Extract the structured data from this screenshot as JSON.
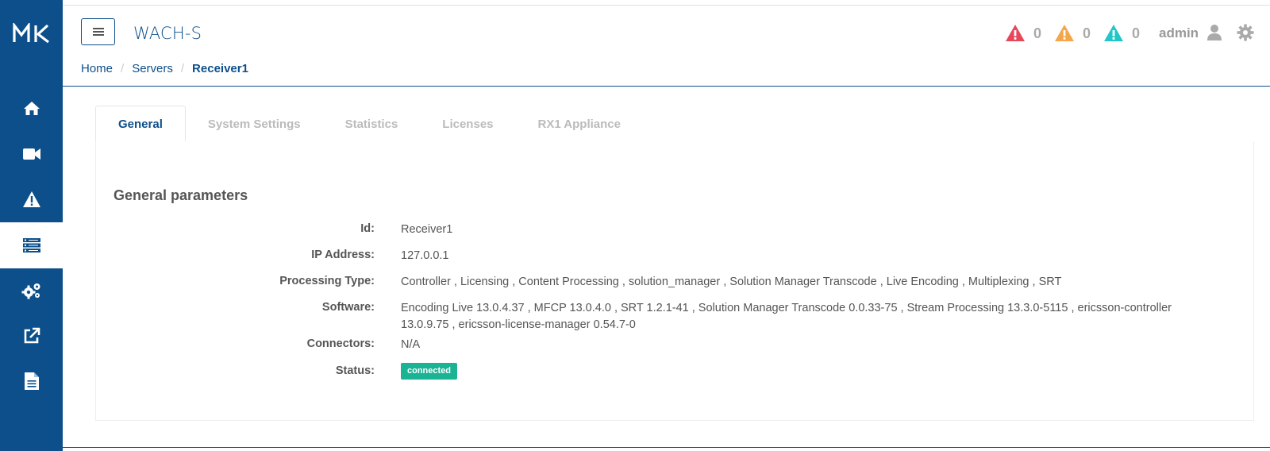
{
  "app": {
    "logo_text": "MK",
    "title": "WACH-S"
  },
  "sidebar": {
    "items": [
      {
        "name": "home",
        "icon": "home-icon"
      },
      {
        "name": "video",
        "icon": "video-camera-icon"
      },
      {
        "name": "alarms",
        "icon": "warning-icon"
      },
      {
        "name": "servers",
        "icon": "server-icon",
        "active": true
      },
      {
        "name": "settings",
        "icon": "cogs-icon"
      },
      {
        "name": "external",
        "icon": "external-link-icon"
      },
      {
        "name": "docs",
        "icon": "document-icon"
      }
    ]
  },
  "header": {
    "alerts": [
      {
        "level": "critical",
        "count": "0",
        "color": "#e5485b"
      },
      {
        "level": "major",
        "count": "0",
        "color": "#f5a54a"
      },
      {
        "level": "minor",
        "count": "0",
        "color": "#23c6c8"
      }
    ],
    "user": "admin"
  },
  "breadcrumb": {
    "home": "Home",
    "servers": "Servers",
    "current": "Receiver1"
  },
  "tabs": [
    {
      "label": "General",
      "active": true
    },
    {
      "label": "System Settings"
    },
    {
      "label": "Statistics"
    },
    {
      "label": "Licenses"
    },
    {
      "label": "RX1 Appliance"
    }
  ],
  "general": {
    "title": "General parameters",
    "rows": [
      {
        "label": "Id:",
        "value": "Receiver1"
      },
      {
        "label": "IP Address:",
        "value": "127.0.0.1"
      },
      {
        "label": "Processing Type:",
        "value": "Controller , Licensing , Content Processing , solution_manager , Solution Manager Transcode , Live Encoding , Multiplexing , SRT"
      },
      {
        "label": "Software:",
        "value_line1": "Encoding Live 13.0.4.37 , MFCP 13.0.4.0 , SRT 1.2.1-41 , Solution Manager Transcode 0.0.33-75 , Stream Processing 13.3.0-5115 , ericsson-controller",
        "value_line2": "13.0.9.75 , ericsson-license-manager 0.54.7-0"
      },
      {
        "label": "Connectors:",
        "value": "N/A"
      },
      {
        "label": "Status:",
        "value": "connected"
      }
    ],
    "status_color": "#1ab394"
  },
  "colors": {
    "brand": "#0d4f8b"
  }
}
